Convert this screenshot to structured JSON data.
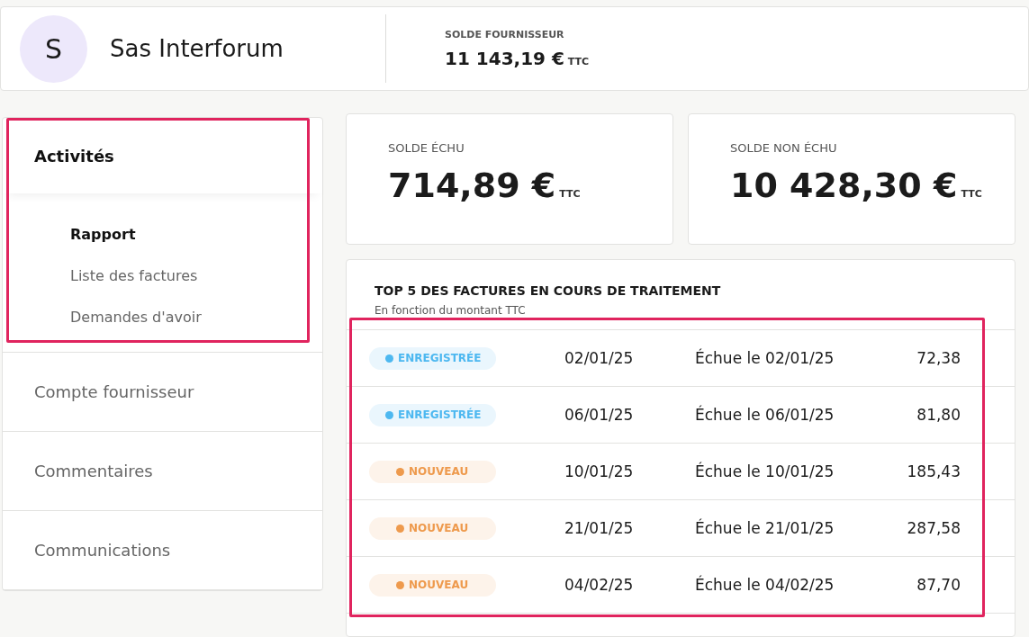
{
  "supplier": {
    "initial": "S",
    "name": "Sas Interforum",
    "balance_label": "SOLDE FOURNISSEUR",
    "balance": "11 143,19 €",
    "balance_suffix": "TTC"
  },
  "sidebar": {
    "items": [
      {
        "label": "Activités",
        "selected": true,
        "expanded": true,
        "highlighted": true,
        "children": [
          {
            "label": "Rapport",
            "selected": true
          },
          {
            "label": "Liste des factures",
            "selected": false
          },
          {
            "label": "Demandes d'avoir",
            "selected": false
          }
        ]
      },
      {
        "label": "Compte fournisseur",
        "selected": false,
        "highlighted": false
      },
      {
        "label": "Commentaires",
        "selected": false,
        "highlighted": false
      },
      {
        "label": "Communications",
        "selected": false,
        "highlighted": false
      }
    ]
  },
  "summary_cards": [
    {
      "label": "SOLDE ÉCHU",
      "amount": "714,89 €",
      "suffix": "TTC"
    },
    {
      "label": "SOLDE NON ÉCHU",
      "amount": "10 428,30 €",
      "suffix": "TTC"
    }
  ],
  "top_invoices": {
    "title": "TOP 5 DES FACTURES EN COURS DE TRAITEMENT",
    "subtitle": "En fonction du montant TTC",
    "highlighted": true,
    "rows": [
      {
        "status": "ENREGISTRÉE",
        "color": "#4db8f0",
        "date": "02/01/25",
        "due": "Échue le 02/01/25",
        "amount": "72,38"
      },
      {
        "status": "ENREGISTRÉE",
        "color": "#4db8f0",
        "date": "06/01/25",
        "due": "Échue le 06/01/25",
        "amount": "81,80"
      },
      {
        "status": "NOUVEAU",
        "color": "#ee9a4d",
        "date": "10/01/25",
        "due": "Échue le 10/01/25",
        "amount": "185,43"
      },
      {
        "status": "NOUVEAU",
        "color": "#ee9a4d",
        "date": "21/01/25",
        "due": "Échue le 21/01/25",
        "amount": "287,58"
      },
      {
        "status": "NOUVEAU",
        "color": "#ee9a4d",
        "date": "04/02/25",
        "due": "Échue le 04/02/25",
        "amount": "87,70"
      }
    ]
  }
}
